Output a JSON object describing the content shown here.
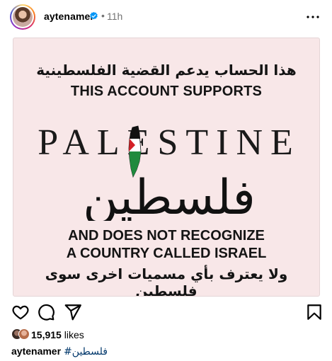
{
  "post": {
    "username": "aytenamer",
    "separator": "•",
    "time": "11h",
    "verified": true,
    "icons": {
      "avatar": "profile-avatar",
      "verified": "verified-badge-icon",
      "more": "more-options-icon",
      "like": "heart-icon",
      "comment": "comment-bubble-icon",
      "share": "paper-plane-icon",
      "save": "bookmark-icon"
    },
    "colors": {
      "verified_blue": "#0095f6",
      "image_background": "#f8e7e8",
      "hashtag": "#00376b",
      "flag_red": "#d32027",
      "flag_green": "#1f8a3d"
    }
  },
  "image_text": {
    "arabic_top": "هذا الحساب يدعم القضية الفلسطينية",
    "english_top": "THIS ACCOUNT SUPPORTS",
    "logo_latin": "PALESTINE",
    "logo_arabic": "فلسطين",
    "english_bottom_1": "AND DOES NOT RECOGNIZE",
    "english_bottom_2": "A COUNTRY CALLED ISRAEL",
    "arabic_bottom": "ولا يعترف بأي مسميات اخرى سوى فلسطين"
  },
  "engagement": {
    "likes_count": "15,915",
    "likes_suffix": " likes"
  },
  "caption": {
    "username": "aytenamer",
    "hashtag": "#فلسطين"
  }
}
